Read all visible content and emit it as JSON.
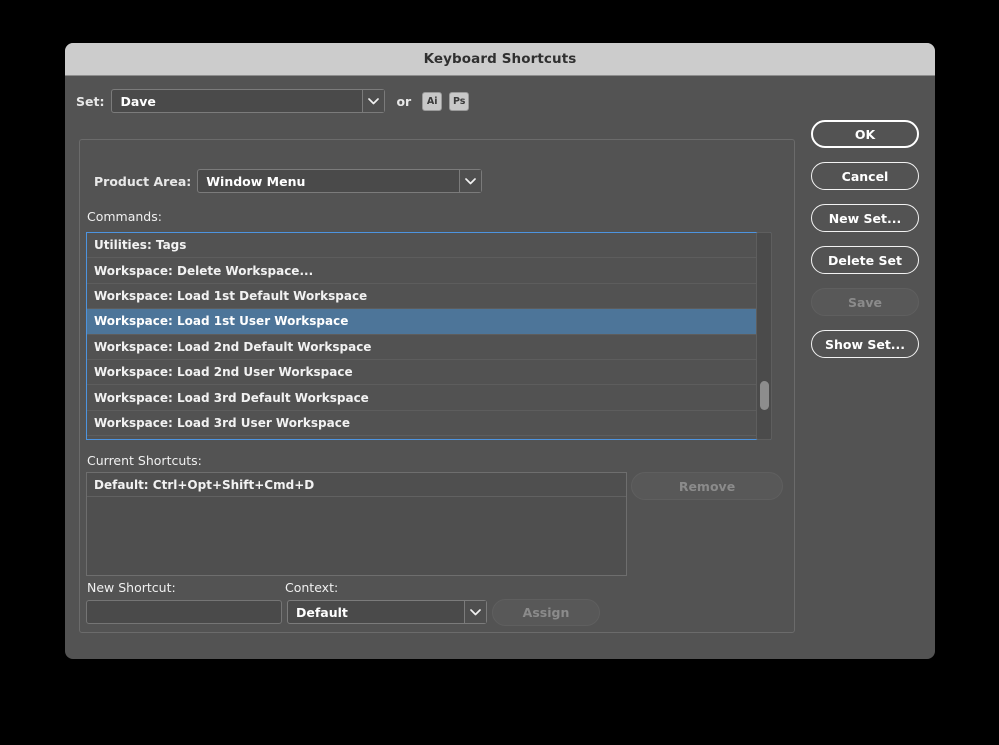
{
  "window": {
    "title": "Keyboard Shortcuts"
  },
  "set_row": {
    "label": "Set:",
    "value": "Dave",
    "or_text": "or",
    "app_buttons": [
      {
        "name": "illustrator-app-button",
        "label": "Ai"
      },
      {
        "name": "photoshop-app-button",
        "label": "Ps"
      }
    ]
  },
  "product_area": {
    "label": "Product Area:",
    "value": "Window Menu"
  },
  "commands": {
    "label": "Commands:",
    "items": [
      {
        "label": "Utilities: Tags",
        "selected": false
      },
      {
        "label": "Workspace: Delete Workspace...",
        "selected": false
      },
      {
        "label": "Workspace: Load 1st Default Workspace",
        "selected": false
      },
      {
        "label": "Workspace: Load 1st User Workspace",
        "selected": true
      },
      {
        "label": "Workspace: Load 2nd Default Workspace",
        "selected": false
      },
      {
        "label": "Workspace: Load 2nd User Workspace",
        "selected": false
      },
      {
        "label": "Workspace: Load 3rd Default Workspace",
        "selected": false
      },
      {
        "label": "Workspace: Load 3rd User Workspace",
        "selected": false
      }
    ]
  },
  "current_shortcuts": {
    "label": "Current Shortcuts:",
    "items": [
      {
        "label": "Default: Ctrl+Opt+Shift+Cmd+D"
      }
    ],
    "remove_label": "Remove",
    "remove_enabled": false
  },
  "new_shortcut": {
    "label": "New Shortcut:",
    "value": "",
    "placeholder": ""
  },
  "context": {
    "label": "Context:",
    "value": "Default"
  },
  "assign": {
    "label": "Assign",
    "enabled": false
  },
  "buttons": [
    {
      "name": "ok-button",
      "label": "OK",
      "style": "default",
      "enabled": true
    },
    {
      "name": "cancel-button",
      "label": "Cancel",
      "style": "normal",
      "enabled": true
    },
    {
      "name": "new-set-button",
      "label": "New Set...",
      "style": "normal",
      "enabled": true
    },
    {
      "name": "delete-set-button",
      "label": "Delete Set",
      "style": "normal",
      "enabled": true
    },
    {
      "name": "save-button",
      "label": "Save",
      "style": "disabled",
      "enabled": false
    },
    {
      "name": "show-set-button",
      "label": "Show Set...",
      "style": "normal",
      "enabled": true
    }
  ],
  "colors": {
    "dialog_background": "#535353",
    "titlebar_background": "#cccccc",
    "selection_blue": "#4d7599",
    "focus_border_blue": "#4d94e0",
    "field_background": "#4a4a4a",
    "disabled_text": "#8b8b8b"
  }
}
